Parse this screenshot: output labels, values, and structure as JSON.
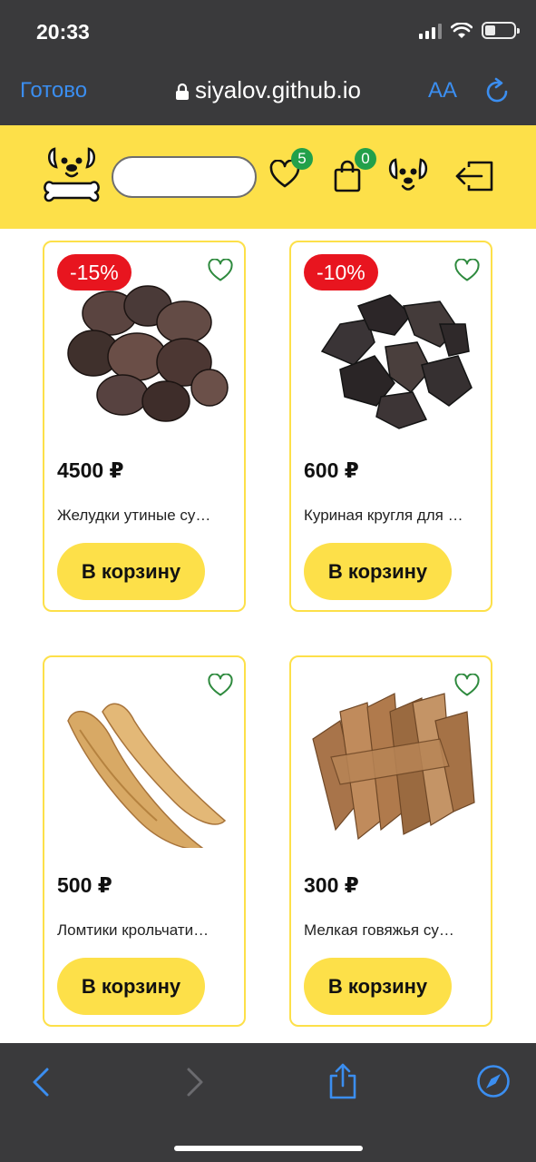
{
  "status_bar": {
    "time": "20:33"
  },
  "browser": {
    "done_label": "Готово",
    "url": "siyalov.github.io",
    "text_size_label": "AA"
  },
  "header": {
    "search": {
      "value": "",
      "placeholder": ""
    },
    "favorites_count": "5",
    "cart_count": "0"
  },
  "products": [
    {
      "discount": "-15%",
      "price": "4500 ₽",
      "name": "Желудки утиные су…",
      "button_label": "В корзину"
    },
    {
      "discount": "-10%",
      "price": "600 ₽",
      "name": "Куриная кругля для …",
      "button_label": "В корзину"
    },
    {
      "discount": "",
      "price": "500 ₽",
      "name": "Ломтики крольчати…",
      "button_label": "В корзину"
    },
    {
      "discount": "",
      "price": "300 ₽",
      "name": "Мелкая говяжья су…",
      "button_label": "В корзину"
    }
  ],
  "colors": {
    "accent_yellow": "#fde049",
    "discount_red": "#e8151f",
    "badge_green": "#22a04a",
    "favorite_green": "#2e8a3e",
    "browser_blue": "#3b8ef0",
    "browser_chrome": "#3a3a3c"
  },
  "icons": [
    "dog-bone-logo-icon",
    "heart-icon",
    "shopping-bag-icon",
    "dog-face-icon",
    "logout-icon",
    "lock-icon",
    "reload-icon",
    "back-arrow-icon",
    "forward-arrow-icon",
    "share-icon",
    "compass-icon"
  ]
}
